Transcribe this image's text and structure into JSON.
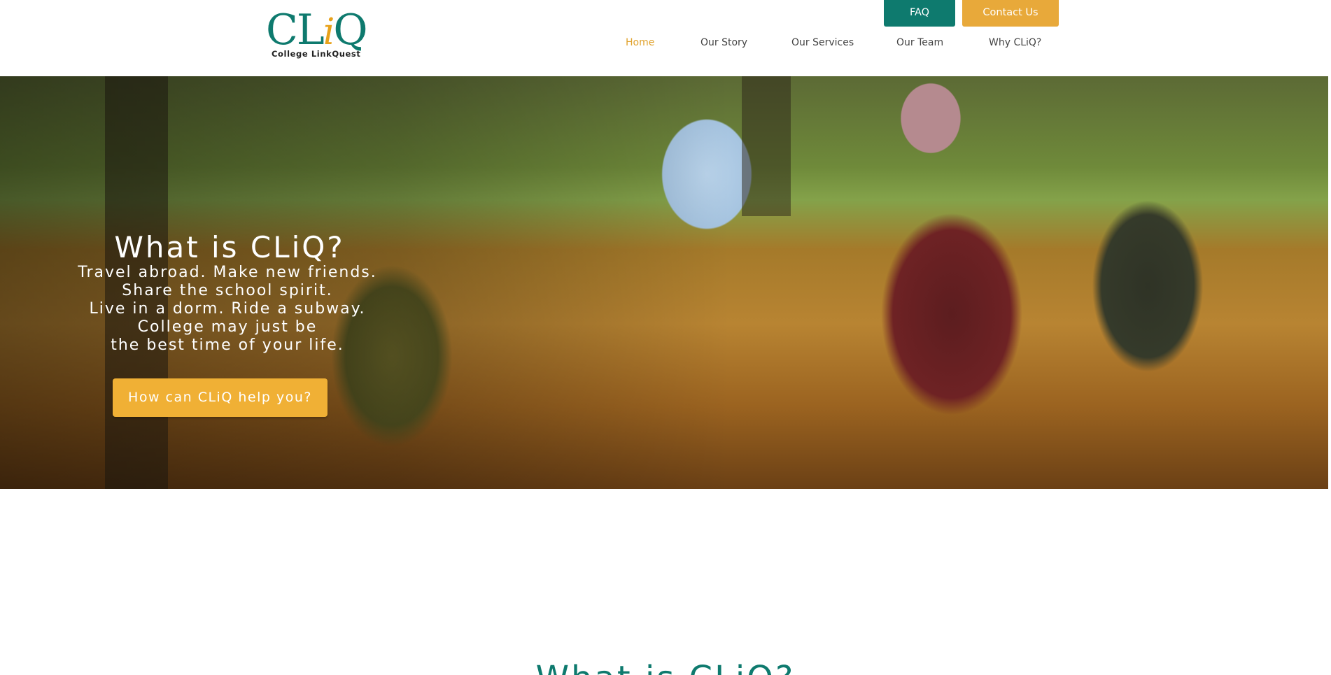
{
  "header": {
    "logo": {
      "mark_c": "C",
      "mark_l": "L",
      "mark_i": "i",
      "mark_q": "Q",
      "tagline": "College LinkQuest"
    },
    "top_buttons": {
      "faq": "FAQ",
      "contact": "Contact Us"
    },
    "nav": {
      "items": [
        "Home",
        "Our Story",
        "Our Services",
        "Our Team",
        "Why CLiQ?"
      ],
      "active": "Home"
    }
  },
  "hero": {
    "title": "What is CLiQ?",
    "lines": [
      "Travel abroad. Make new friends.",
      "Share the school spirit.",
      "Live in a dorm. Ride a subway.",
      "College may just be",
      "the best time of your life."
    ],
    "cta": "How can CLiQ help you?"
  },
  "section": {
    "title": "What is CLiQ?"
  },
  "colors": {
    "teal": "#0e7a6e",
    "gold": "#e8a93a",
    "nav_active": "#e0a22d",
    "cta": "#f0b035"
  }
}
